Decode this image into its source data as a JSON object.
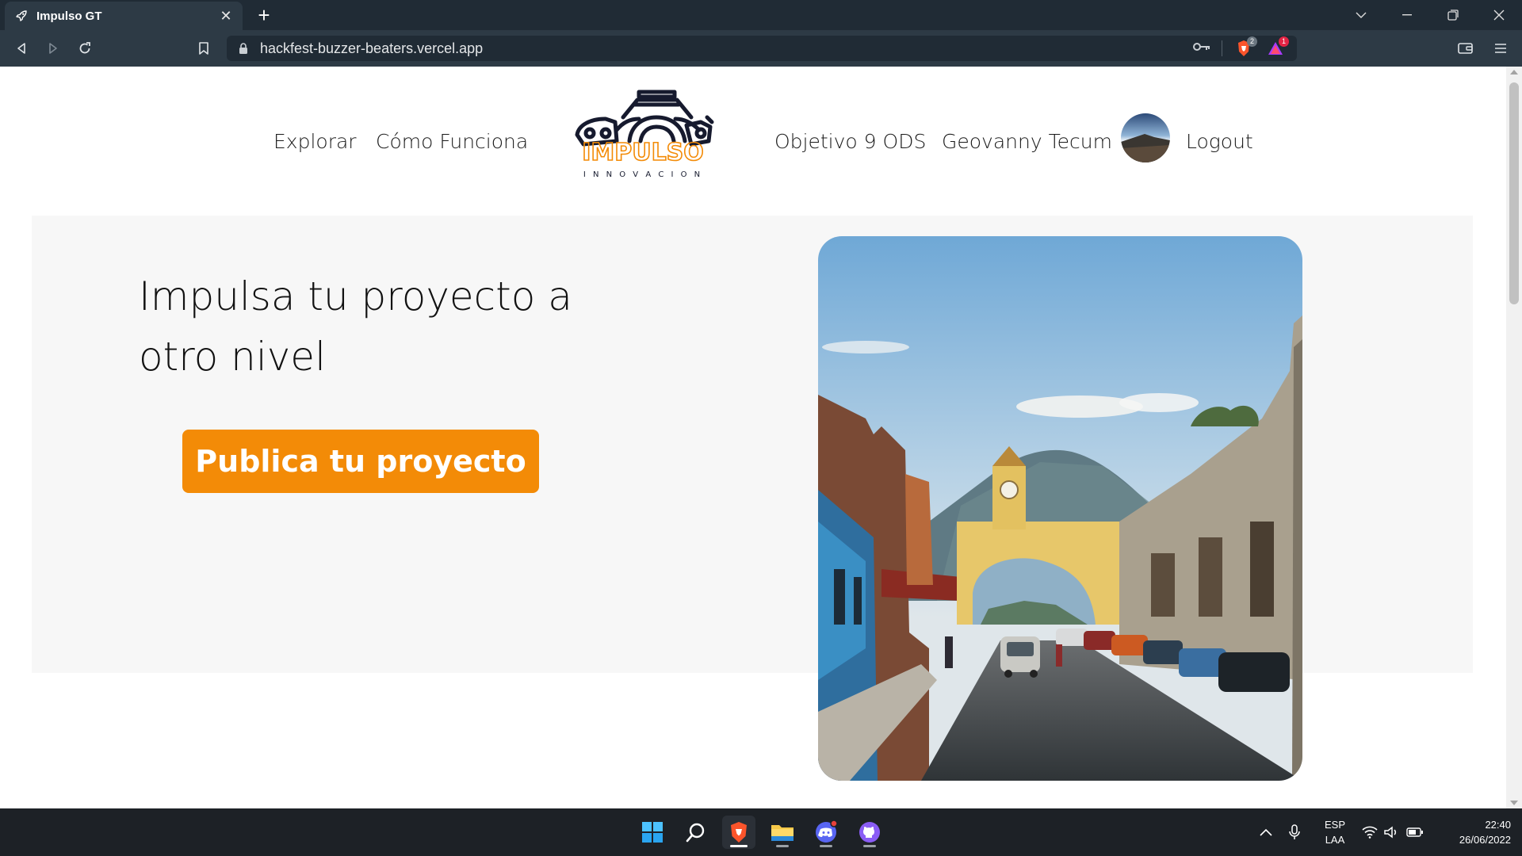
{
  "browser": {
    "tab": {
      "title": "Impulso GT",
      "icon": "rocket-icon"
    },
    "new_tab_label": "+",
    "url": "hackfest-buzzer-beaters.vercel.app",
    "brave_shield_count": "2",
    "rewards_count": "1"
  },
  "nav": {
    "explorar": "Explorar",
    "como_funciona": "Cómo Funciona",
    "logo_text": "IMPULSO",
    "logo_subtext": "I N N O V A C I O N",
    "objetivo": "Objetivo 9 ODS",
    "user_name": "Geovanny Tecum",
    "logout": "Logout"
  },
  "hero": {
    "title_line1": "Impulsa tu proyecto a",
    "title_line2": "otro nivel",
    "cta": "Publica tu proyecto"
  },
  "colors": {
    "accent": "#f38b07",
    "hero_bg": "#f7f7f7",
    "chrome_dark": "#202b35",
    "chrome_toolbar": "#2d3a45"
  },
  "taskbar": {
    "apps": [
      "windows-start-icon",
      "search-icon",
      "brave-browser-icon",
      "file-explorer-icon",
      "discord-icon",
      "github-desktop-icon"
    ],
    "lang_line1": "ESP",
    "lang_line2": "LAA",
    "time": "22:40",
    "date": "26/06/2022"
  }
}
